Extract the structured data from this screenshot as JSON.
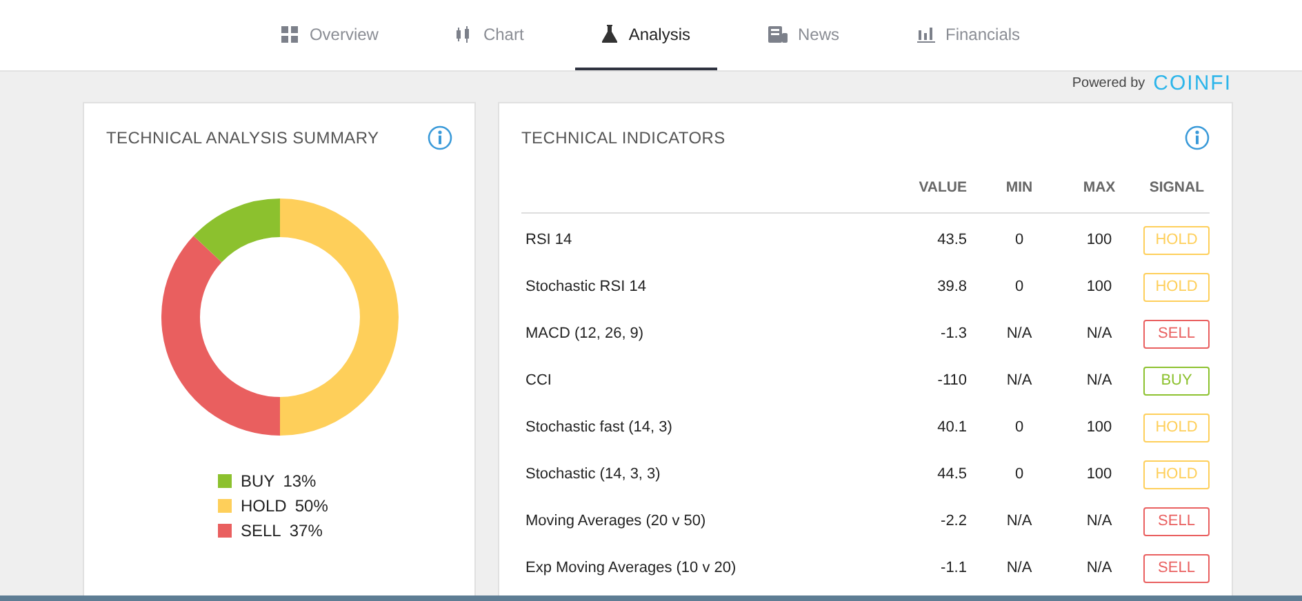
{
  "tabs": [
    {
      "label": "Overview",
      "kind": "grid",
      "selected": false
    },
    {
      "label": "Chart",
      "kind": "candles",
      "selected": false
    },
    {
      "label": "Analysis",
      "kind": "flask",
      "selected": true
    },
    {
      "label": "News",
      "kind": "newspaper",
      "selected": false
    },
    {
      "label": "Financials",
      "kind": "bars",
      "selected": false
    }
  ],
  "powered_by": {
    "label": "Powered by",
    "logo": "COINFI"
  },
  "summary": {
    "title": "TECHNICAL ANALYSIS SUMMARY",
    "chart_data": {
      "type": "donut",
      "categories": [
        "BUY",
        "HOLD",
        "SELL"
      ],
      "values": [
        13,
        50,
        37
      ],
      "colors": [
        "#8cc12e",
        "#fecf5a",
        "#e95f5f"
      ]
    },
    "legend": [
      {
        "value": "13%"
      },
      {
        "value": "50%"
      },
      {
        "value": "37%"
      }
    ]
  },
  "indicators": {
    "title": "TECHNICAL INDICATORS",
    "columns": [
      "VALUE",
      "MIN",
      "MAX",
      "SIGNAL"
    ],
    "rows": [
      {
        "name": "RSI 14",
        "value": "43.5",
        "min": "0",
        "max": "100",
        "signal": "HOLD",
        "color": "#fecf5a"
      },
      {
        "name": "Stochastic RSI 14",
        "value": "39.8",
        "min": "0",
        "max": "100",
        "signal": "HOLD",
        "color": "#fecf5a"
      },
      {
        "name": "MACD (12, 26, 9)",
        "value": "-1.3",
        "min": "N/A",
        "max": "N/A",
        "signal": "SELL",
        "color": "#e95f5f"
      },
      {
        "name": "CCI",
        "value": "-110",
        "min": "N/A",
        "max": "N/A",
        "signal": "BUY",
        "color": "#8cc12e"
      },
      {
        "name": "Stochastic fast (14, 3)",
        "value": "40.1",
        "min": "0",
        "max": "100",
        "signal": "HOLD",
        "color": "#fecf5a"
      },
      {
        "name": "Stochastic (14, 3, 3)",
        "value": "44.5",
        "min": "0",
        "max": "100",
        "signal": "HOLD",
        "color": "#fecf5a"
      },
      {
        "name": "Moving Averages (20 v 50)",
        "value": "-2.2",
        "min": "N/A",
        "max": "N/A",
        "signal": "SELL",
        "color": "#e95f5f"
      },
      {
        "name": "Exp Moving Averages (10 v 20)",
        "value": "-1.1",
        "min": "N/A",
        "max": "N/A",
        "signal": "SELL",
        "color": "#e95f5f"
      }
    ]
  }
}
